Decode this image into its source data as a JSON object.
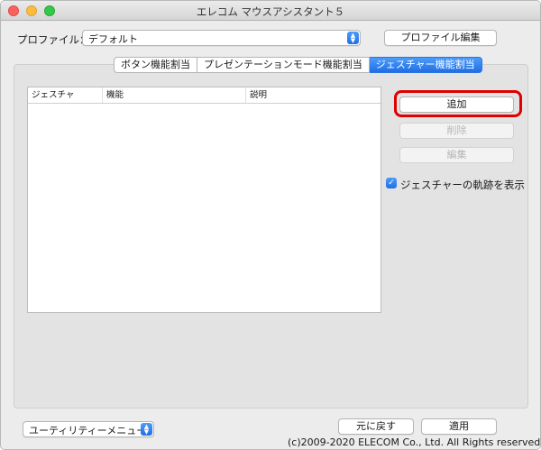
{
  "window": {
    "title": "エレコム マウスアシスタント５"
  },
  "profile": {
    "label": "プロファイル：",
    "selected": "デフォルト",
    "edit_button": "プロファイル編集"
  },
  "tabs": [
    {
      "label": "ボタン機能割当"
    },
    {
      "label": "プレゼンテーションモード機能割当"
    },
    {
      "label": "ジェスチャー機能割当"
    }
  ],
  "table": {
    "columns": [
      "ジェスチャ",
      "機能",
      "説明"
    ]
  },
  "actions": {
    "add": "追加",
    "delete": "削除",
    "edit": "編集"
  },
  "show_trail": {
    "label": "ジェスチャーの軌跡を表示",
    "checked": true
  },
  "footer": {
    "utility_menu": "ユーティリティーメニュー",
    "revert": "元に戻す",
    "apply": "適用",
    "copyright": "(c)2009-2020 ELECOM Co., Ltd. All Rights reserved."
  }
}
